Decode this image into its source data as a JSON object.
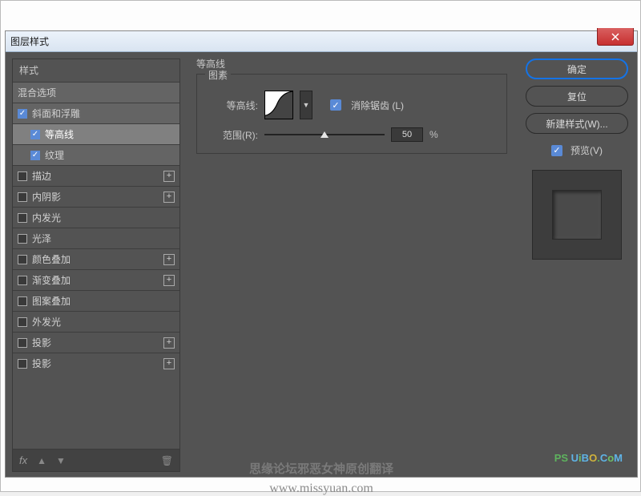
{
  "window": {
    "title": "图层样式"
  },
  "left": {
    "header": "样式",
    "blend_options": "混合选项",
    "items": [
      {
        "label": "斜面和浮雕",
        "checked": true,
        "plus": false,
        "indent": 0,
        "lighter": true
      },
      {
        "label": "等高线",
        "checked": true,
        "plus": false,
        "indent": 1,
        "selected": true
      },
      {
        "label": "纹理",
        "checked": true,
        "plus": false,
        "indent": 1,
        "lighter": true
      },
      {
        "label": "描边",
        "checked": false,
        "plus": true,
        "indent": 0
      },
      {
        "label": "内阴影",
        "checked": false,
        "plus": true,
        "indent": 0
      },
      {
        "label": "内发光",
        "checked": false,
        "plus": false,
        "indent": 0
      },
      {
        "label": "光泽",
        "checked": false,
        "plus": false,
        "indent": 0
      },
      {
        "label": "颜色叠加",
        "checked": false,
        "plus": true,
        "indent": 0
      },
      {
        "label": "渐变叠加",
        "checked": false,
        "plus": true,
        "indent": 0
      },
      {
        "label": "图案叠加",
        "checked": false,
        "plus": false,
        "indent": 0
      },
      {
        "label": "外发光",
        "checked": false,
        "plus": false,
        "indent": 0
      },
      {
        "label": "投影",
        "checked": false,
        "plus": true,
        "indent": 0
      },
      {
        "label": "投影",
        "checked": false,
        "plus": true,
        "indent": 0
      }
    ],
    "footer_fx": "fx"
  },
  "center": {
    "title": "等高线",
    "group": "图素",
    "contour_label": "等高线:",
    "anti_alias_label": "消除锯齿 (L)",
    "range_label": "范围(R):",
    "range_value": "50",
    "range_unit": "%"
  },
  "right": {
    "ok": "确定",
    "reset": "复位",
    "new_style": "新建样式(W)...",
    "preview_label": "预览(V)"
  },
  "watermark": {
    "line1": "思缘论坛邪恶女神原创翻译",
    "line2": "www.missyuan.com",
    "logo_prefix": "PS",
    "logo_brand": "UiBO.CoM"
  }
}
